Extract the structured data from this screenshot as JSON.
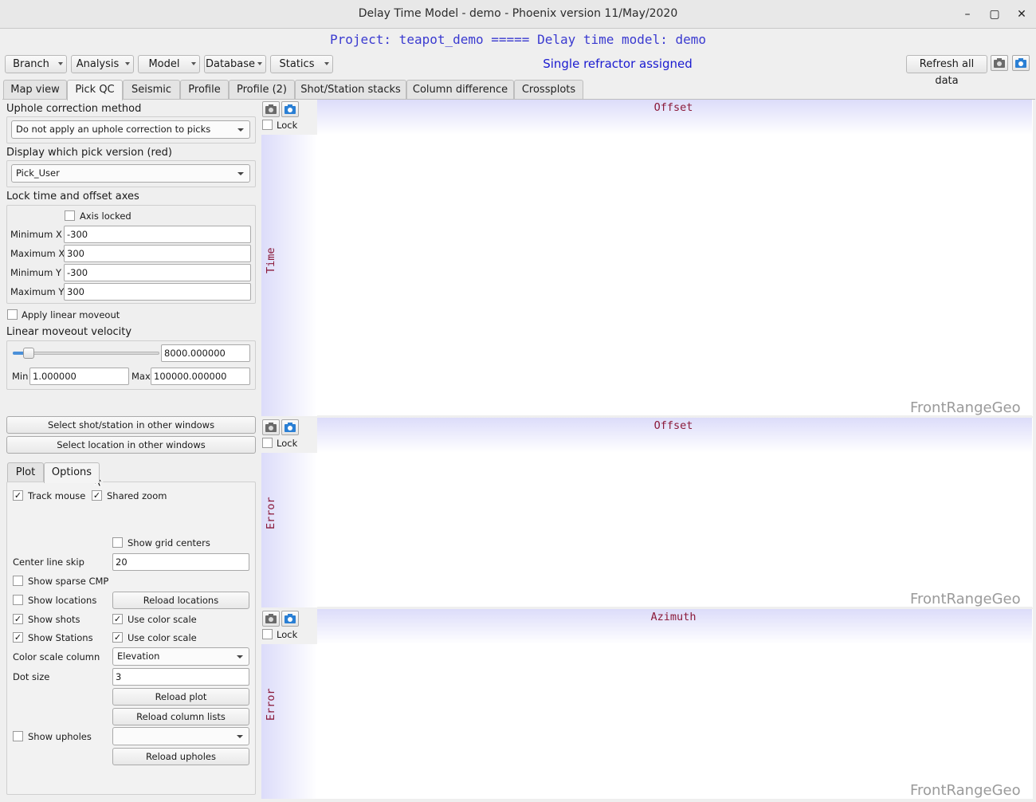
{
  "window": {
    "title": "Delay Time Model - demo - Phoenix version 11/May/2020",
    "minimize": "–",
    "maximize": "▢",
    "close": "✕"
  },
  "project_line": "Project: teapot_demo ===== Delay time model: demo",
  "toolbar": {
    "menus": [
      "Branch",
      "Analysis",
      "Model",
      "Database",
      "Statics"
    ],
    "status": "Single refractor assigned",
    "refresh_label": "Refresh all data"
  },
  "main_tabs": [
    "Map view",
    "Pick QC",
    "Seismic",
    "Profile",
    "Profile (2)",
    "Shot/Station stacks",
    "Column difference",
    "Crossplots"
  ],
  "active_main_tab": "Pick QC",
  "left": {
    "uphole_label": "Uphole correction method",
    "uphole_value": "Do not apply an uphole correction to picks",
    "pick_version_label": "Display which pick version (red)",
    "pick_version_value": "Pick_User",
    "lock_label": "Lock time and offset axes",
    "axis_locked_label": "Axis locked",
    "axis_locked": false,
    "min_x_label": "Minimum X",
    "min_x": "-300",
    "max_x_label": "Maximum X",
    "max_x": "300",
    "min_y_label": "Minimum Y",
    "min_y": "-300",
    "max_y_label": "Maximum Y",
    "max_y": "300",
    "apply_lmo_label": "Apply linear moveout",
    "apply_lmo": false,
    "lmo_velocity_label": "Linear moveout velocity",
    "lmo_velocity": "8000.000000",
    "lmo_slider_fraction": 0.08,
    "min_label": "Min",
    "min_value": "1.000000",
    "max_label": "Max",
    "max_value": "100000.000000",
    "select_shot_btn": "Select shot/station in other windows",
    "select_location_btn": "Select location in other windows"
  },
  "sub_tabs": [
    "Plot",
    "Options"
  ],
  "active_sub_tab": "Options",
  "options": {
    "track_mouse_label": "Track mouse",
    "track_mouse": true,
    "shared_zoom_label": "Shared zoom",
    "shared_zoom": true,
    "show_grid_centers_label": "Show grid centers",
    "show_grid_centers": false,
    "center_line_skip_label": "Center line skip",
    "center_line_skip": "20",
    "show_sparse_cmp_label": "Show sparse CMP",
    "show_sparse_cmp": false,
    "show_locations_label": "Show locations",
    "show_locations": false,
    "reload_locations_btn": "Reload locations",
    "show_shots_label": "Show shots",
    "show_shots": true,
    "shots_color_scale_label": "Use color scale",
    "shots_color_scale": true,
    "show_stations_label": "Show Stations",
    "show_stations": true,
    "stations_color_scale_label": "Use color scale",
    "stations_color_scale": true,
    "color_scale_column_label": "Color scale column",
    "color_scale_column": "Elevation",
    "dot_size_label": "Dot size",
    "dot_size": "3",
    "reload_plot_btn": "Reload plot",
    "reload_column_lists_btn": "Reload column lists",
    "show_upholes_label": "Show upholes",
    "show_upholes": false,
    "upholes_value": "",
    "reload_upholes_btn": "Reload upholes"
  },
  "plots": [
    {
      "x_label": "Offset",
      "y_label": "Time",
      "lock_label": "Lock",
      "watermark": "FrontRangeGeo"
    },
    {
      "x_label": "Offset",
      "y_label": "Error",
      "lock_label": "Lock",
      "watermark": "FrontRangeGeo"
    },
    {
      "x_label": "Azimuth",
      "y_label": "Error",
      "lock_label": "Lock",
      "watermark": "FrontRangeGeo"
    }
  ],
  "colors": {
    "project_text": "#3a3ad0",
    "status_text": "#1a1ad0",
    "plot_label": "#8b1a3a",
    "plot_gradient": "#dcdcfa",
    "watermark": "#9a9a9a"
  }
}
